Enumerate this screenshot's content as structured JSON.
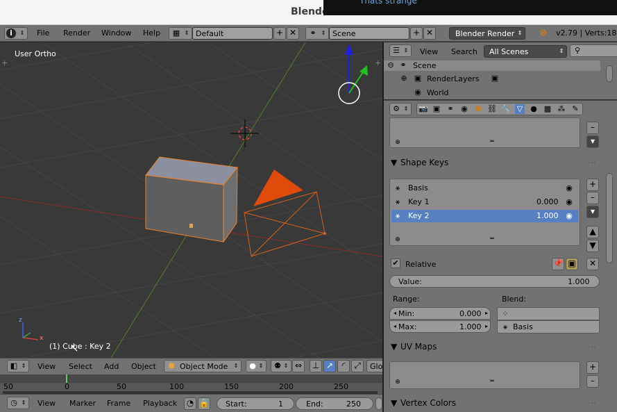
{
  "window": {
    "title": "Blende",
    "notification": "Thats strange"
  },
  "info_header": {
    "menus": [
      "File",
      "Render",
      "Window",
      "Help"
    ],
    "layout_name": "Default",
    "scene_name": "Scene",
    "render_engine": "Blender Render",
    "status": "v2.79 | Verts:18"
  },
  "viewport": {
    "view_label": "User Ortho",
    "object_info": "(1) Cube : Key 2",
    "axis_z": "z",
    "axis_x": "x"
  },
  "viewport_header": {
    "menus": [
      "View",
      "Select",
      "Add",
      "Object"
    ],
    "mode": "Object Mode",
    "pivot_label": "Glo"
  },
  "timeline": {
    "ticks": [
      "50",
      "0",
      "50",
      "100",
      "150",
      "200",
      "250"
    ],
    "menus": [
      "View",
      "Marker",
      "Frame",
      "Playback"
    ],
    "start_label": "Start:",
    "start_value": "1",
    "end_label": "End:",
    "end_value": "250"
  },
  "outliner": {
    "menus": [
      "View",
      "Search"
    ],
    "filter": "All Scenes",
    "items": [
      {
        "label": "Scene"
      },
      {
        "label": "RenderLayers"
      },
      {
        "label": "World"
      }
    ]
  },
  "properties": {
    "shape_keys": {
      "title": "Shape Keys",
      "keys": [
        {
          "name": "Basis",
          "value": ""
        },
        {
          "name": "Key 1",
          "value": "0.000"
        },
        {
          "name": "Key 2",
          "value": "1.000"
        }
      ],
      "relative_label": "Relative",
      "value_label": "Value:",
      "value": "1.000",
      "range_label": "Range:",
      "blend_label": "Blend:",
      "min_label": "Min:",
      "min_value": "0.000",
      "max_label": "Max:",
      "max_value": "1.000",
      "blend_value": "Basis"
    },
    "uv_maps": {
      "title": "UV Maps"
    },
    "vertex_colors": {
      "title": "Vertex Colors"
    }
  },
  "colors": {
    "accent": "#5680c2",
    "selection": "#f0822a",
    "x_axis": "#9b2b2b",
    "y_axis": "#5a8a2a"
  }
}
